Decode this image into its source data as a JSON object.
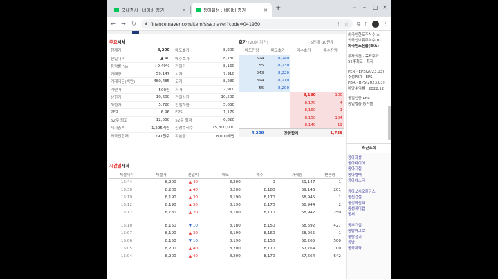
{
  "tabs": [
    {
      "label": "국내증시 : 네이버 증권",
      "active": false
    },
    {
      "label": "동아화성 : 네이버 증권",
      "active": true
    }
  ],
  "address": "finance.naver.com/item/sise.naver?code=041930",
  "quote_section": {
    "title_red": "주요",
    "title": "시세",
    "rows": [
      [
        "현재가",
        "8,200",
        "매도호가",
        "8,200"
      ],
      [
        "전일대비",
        "▲ 40",
        "매수호가",
        "8,180"
      ],
      [
        "등락률(%)",
        "+0.49%",
        "전일가",
        "8,160"
      ],
      [
        "거래량",
        "59,147",
        "시가",
        "7,910"
      ],
      [
        "거래대금(백만)",
        "480,485",
        "고가",
        "8,280"
      ],
      [
        "액면가",
        "500원",
        "저가",
        "7,910"
      ],
      [
        "상한가",
        "10,600",
        "전일상한",
        "10,500"
      ],
      [
        "하한가",
        "5,720",
        "전일하한",
        "5,660"
      ],
      [
        "PER",
        "6.96",
        "EPS",
        "1,179"
      ],
      [
        "52주 최고",
        "12,550",
        "52주 최저",
        "6,820"
      ],
      [
        "시가총액",
        "1,295억원",
        "상장주식수",
        "15,800,000"
      ],
      [
        "외국인현재",
        "297천주",
        "자본금",
        "8,000백만"
      ]
    ]
  },
  "orderbook": {
    "title": "호가",
    "subtitle": "(20분 지연)",
    "links": [
      "5단계",
      "10단계"
    ],
    "headers": [
      "매도잔량",
      "매도호가",
      "매수호가",
      "매수잔량"
    ],
    "asks": [
      [
        "524",
        "8,240"
      ],
      [
        "55",
        "8,230"
      ],
      [
        "243",
        "8,220"
      ],
      [
        "394",
        "8,210"
      ],
      [
        "55",
        "8,200"
      ]
    ],
    "bids": [
      [
        "8,180",
        "100"
      ],
      [
        "8,170",
        "4"
      ],
      [
        "8,160",
        "1"
      ],
      [
        "8,150",
        "104"
      ],
      [
        "8,140",
        "19"
      ]
    ],
    "total_ask": "4,209",
    "total_label": "잔량합계",
    "total_bid": "1,738"
  },
  "ticks_section": {
    "title_red": "시간별",
    "title": "시세",
    "headers": [
      "체결시각",
      "체결가",
      "전일비",
      "매도",
      "매수",
      "거래량",
      "변동량"
    ],
    "rows": [
      [
        "15:44",
        "8,200",
        "▲",
        "40",
        "8,200",
        "0",
        "59,147",
        "1"
      ],
      [
        "15:30",
        "8,200",
        "▲",
        "40",
        "8,200",
        "8,180",
        "59,146",
        "201"
      ],
      [
        "15:19",
        "8,190",
        "▲",
        "30",
        "8,190",
        "8,170",
        "58,945",
        "1"
      ],
      [
        "15:12",
        "8,190",
        "▲",
        "30",
        "8,190",
        "8,170",
        "58,944",
        "2"
      ],
      [
        "15:12",
        "8,180",
        "▲",
        "20",
        "8,180",
        "8,170",
        "58,942",
        "250"
      ],
      [
        "15:10",
        "8,150",
        "▼",
        "10",
        "8,180",
        "8,150",
        "58,692",
        "427"
      ],
      [
        "15:07",
        "8,190",
        "▲",
        "30",
        "8,190",
        "8,160",
        "58,265",
        "1"
      ],
      [
        "15:06",
        "8,150",
        "▼",
        "10",
        "8,190",
        "8,150",
        "58,265",
        "500"
      ],
      [
        "15:05",
        "8,200",
        "▲",
        "40",
        "8,200",
        "8,170",
        "57,764",
        "100"
      ],
      [
        "15:04",
        "8,200",
        "▲",
        "40",
        "8,200",
        "8,170",
        "57,664",
        "642"
      ]
    ]
  },
  "right_panel": {
    "top_lines": [
      "외국인한도주식수(A)",
      "외국인보유주식수(B)",
      "외국인소진율(B/A)"
    ],
    "mid_lines": [
      "투자의견 · 목표주가",
      "52주최고 · 최저"
    ],
    "per_lines": [
      "PER · EPS(2023.03)",
      "추정PER · EPS",
      "PBR · BPS(2023.03)",
      "배당수익률 · 2022.12"
    ],
    "industry_lines": [
      "동일업종 PER",
      "동일업종 등락률"
    ],
    "recent_title": "최근조회",
    "recent_items": [
      "동아화성",
      "동아타이어",
      "동아지질",
      "동아엘텍",
      "동아에스티",
      "",
      "동아쏘시오홀딩스",
      "동신건설",
      "동성화인텍",
      "동성케미컬",
      "동서",
      "",
      "동부건설",
      "동방아그로",
      "동방선기",
      "동방",
      "동국제약"
    ]
  }
}
